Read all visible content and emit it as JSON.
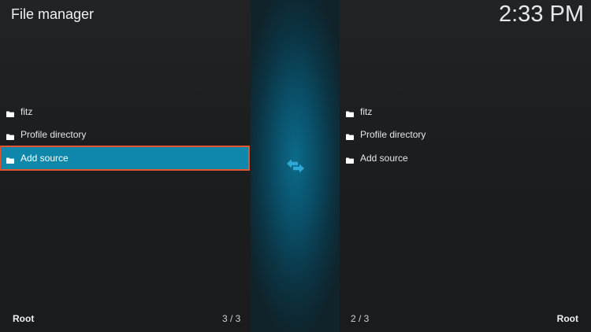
{
  "header": {
    "title": "File manager",
    "clock": "2:33 PM"
  },
  "left_pane": {
    "items": [
      {
        "label": "fitz",
        "icon": "folder-icon",
        "selected": false
      },
      {
        "label": "Profile directory",
        "icon": "folder-icon",
        "selected": false
      },
      {
        "label": "Add source",
        "icon": "folder-icon",
        "selected": true
      }
    ],
    "footer_label": "Root",
    "footer_count": "3 / 3"
  },
  "right_pane": {
    "items": [
      {
        "label": "fitz",
        "icon": "folder-icon"
      },
      {
        "label": "Profile directory",
        "icon": "folder-icon"
      },
      {
        "label": "Add source",
        "icon": "folder-icon"
      }
    ],
    "footer_label": "Root",
    "footer_count": "2 / 3"
  },
  "center": {
    "icon": "swap-arrows-icon"
  },
  "colors": {
    "background": "#1b1d1f",
    "selection": "#0f87aa",
    "selection_outline": "#e3562d",
    "accent": "#2fa8d8"
  }
}
